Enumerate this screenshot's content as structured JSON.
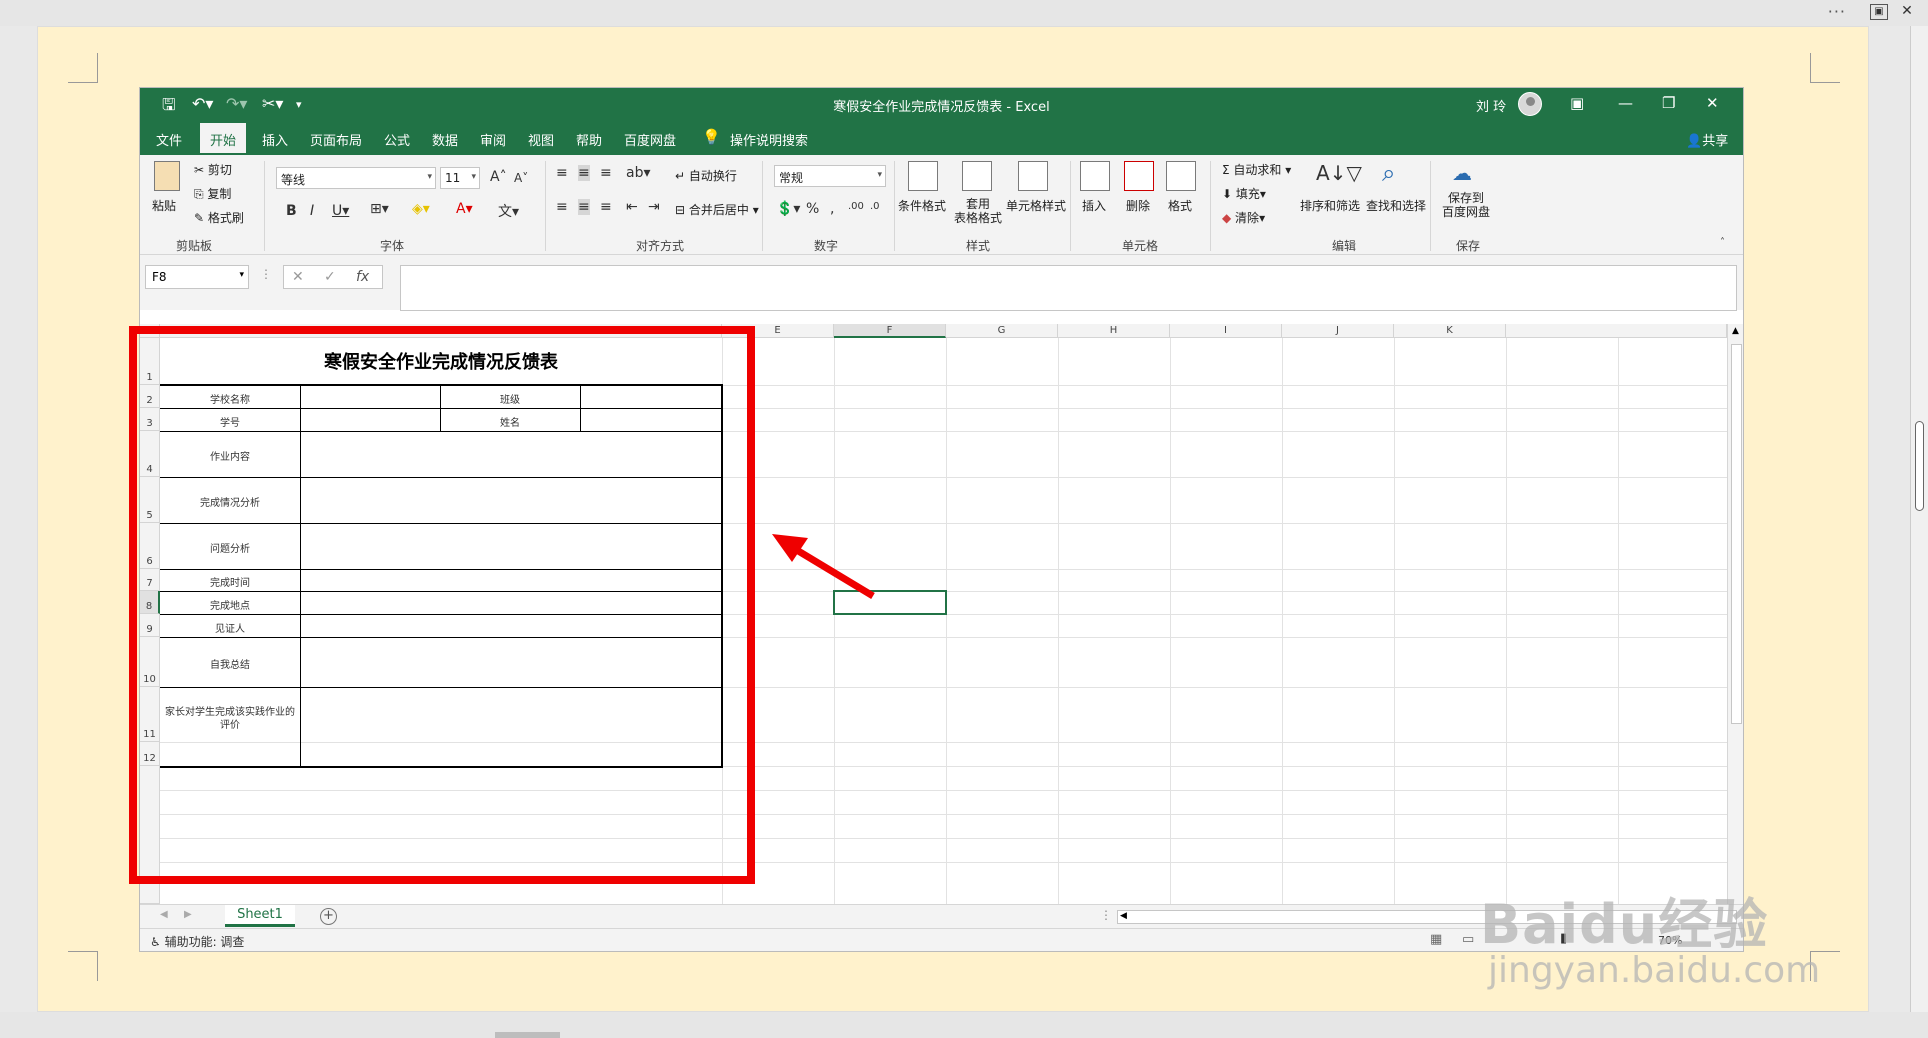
{
  "window": {
    "title": "寒假安全作业完成情况反馈表  -  Excel",
    "user": "刘 玲",
    "share": "共享"
  },
  "menu": [
    "文件",
    "开始",
    "插入",
    "页面布局",
    "公式",
    "数据",
    "审阅",
    "视图",
    "帮助",
    "百度网盘",
    "操作说明搜索"
  ],
  "ribbon": {
    "clipboard": {
      "paste": "粘贴",
      "cut": "剪切",
      "copy": "复制",
      "format_painter": "格式刷",
      "label": "剪贴板"
    },
    "font": {
      "name": "等线",
      "size": "11",
      "label": "字体"
    },
    "alignment": {
      "wrap": "自动换行",
      "merge": "合并后居中",
      "label": "对齐方式"
    },
    "number": {
      "format": "常规",
      "label": "数字"
    },
    "styles": {
      "conditional": "条件格式",
      "table": "套用\n表格格式",
      "cell": "单元格样式",
      "label": "样式"
    },
    "cells": {
      "insert": "插入",
      "delete": "删除",
      "format": "格式",
      "label": "单元格"
    },
    "editing": {
      "autosum": "自动求和",
      "fill": "填充",
      "clear": "清除",
      "sort": "排序和筛选",
      "find": "查找和选择",
      "label": "编辑"
    },
    "save": {
      "save_to": "保存到\n百度网盘",
      "label": "保存"
    }
  },
  "formula": {
    "namebox": "F8",
    "fx": "fx"
  },
  "columns": [
    "E",
    "F",
    "G",
    "H",
    "I",
    "J",
    "K"
  ],
  "rows": [
    "1",
    "2",
    "3",
    "4",
    "5",
    "6",
    "7",
    "8",
    "9",
    "10",
    "11",
    "12"
  ],
  "form": {
    "title": "寒假安全作业完成情况反馈表",
    "school": "学校名称",
    "class": "班级",
    "student_id": "学号",
    "name": "姓名",
    "content": "作业内容",
    "analysis": "完成情况分析",
    "problems": "问题分析",
    "time": "完成时间",
    "place": "完成地点",
    "witness": "见证人",
    "summary": "自我总结",
    "parent_eval": "家长对学生完成该实践作业的评价"
  },
  "sheet": {
    "tab": "Sheet1",
    "status": "辅助功能: 调查",
    "zoom": "70%"
  },
  "watermark": {
    "brand": "Baidu经验",
    "url": "jingyan.baidu.com"
  },
  "colors": {
    "excel_green": "#217346",
    "highlight_red": "#ef0000",
    "page_bg": "#fff2cc"
  }
}
